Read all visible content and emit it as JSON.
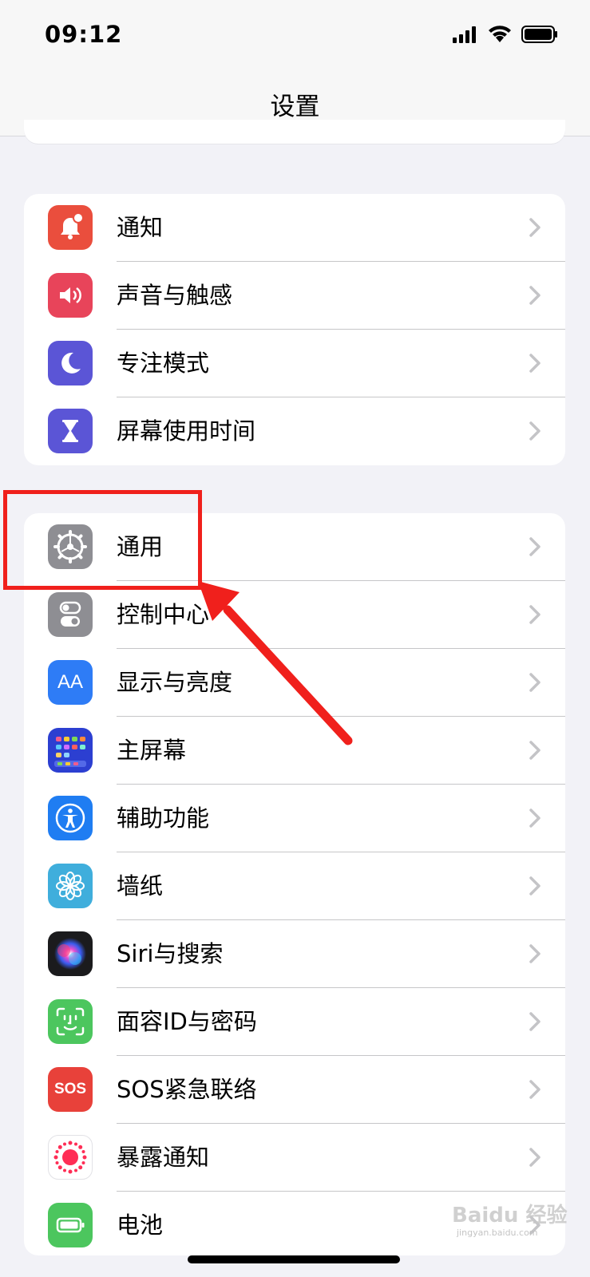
{
  "status_bar": {
    "time": "09:12"
  },
  "nav": {
    "title": "设置"
  },
  "groups": [
    {
      "items": [
        {
          "label": "通知",
          "icon": "notification-bell-icon",
          "color": "#ea4e3d"
        },
        {
          "label": "声音与触感",
          "icon": "speaker-icon",
          "color": "#e8445a"
        },
        {
          "label": "专注模式",
          "icon": "moon-icon",
          "color": "#5b55d6"
        },
        {
          "label": "屏幕使用时间",
          "icon": "hourglass-icon",
          "color": "#5b55d6"
        }
      ]
    },
    {
      "items": [
        {
          "label": "通用",
          "icon": "gear-icon",
          "color": "#8e8e93"
        },
        {
          "label": "控制中心",
          "icon": "toggle-icon",
          "color": "#8e8e93"
        },
        {
          "label": "显示与亮度",
          "icon": "text-size-icon",
          "color": "#2e7cf6"
        },
        {
          "label": "主屏幕",
          "icon": "home-grid-icon",
          "color": "#2c3fd1"
        },
        {
          "label": "辅助功能",
          "icon": "accessibility-icon",
          "color": "#1f7df2"
        },
        {
          "label": "墙纸",
          "icon": "flower-icon",
          "color": "#3faedc"
        },
        {
          "label": "Siri与搜索",
          "icon": "siri-icon",
          "color": "#1b1b1d"
        },
        {
          "label": "面容ID与密码",
          "icon": "face-id-icon",
          "color": "#4cc65e"
        },
        {
          "label": "SOS紧急联络",
          "icon": "sos-icon",
          "color": "#e8413a"
        },
        {
          "label": "暴露通知",
          "icon": "exposure-icon",
          "color": "#ffffff"
        },
        {
          "label": "电池",
          "icon": "battery-icon",
          "color": "#4cc65e"
        }
      ]
    }
  ],
  "sos_text": "SOS",
  "display_icon_text": "AA",
  "watermark": {
    "main": "Baidu 经验",
    "sub": "jingyan.baidu.com"
  },
  "annotation_color": "#f0201c"
}
